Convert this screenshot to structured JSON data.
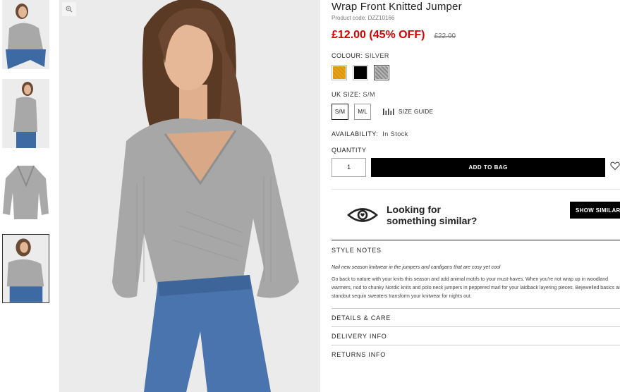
{
  "product": {
    "title": "Wrap Front Knitted Jumper",
    "code": "Product code: DZZ10166",
    "price": "£12.00 (45% OFF)",
    "old_price": "£22.00"
  },
  "colour": {
    "label": "COLOUR:",
    "value": "SILVER",
    "swatches": [
      {
        "name": "mustard",
        "color": "#e8a317"
      },
      {
        "name": "black",
        "color": "#000000"
      },
      {
        "name": "silver",
        "color": "#9a9a9a"
      }
    ]
  },
  "size": {
    "label": "UK SIZE:",
    "value": "S/M",
    "options": [
      "S/M",
      "M/L"
    ],
    "guide": "SIZE GUIDE"
  },
  "availability": {
    "label": "AVAILABILITY:",
    "value": "In Stock"
  },
  "quantity": {
    "label": "QUANTITY",
    "value": "1"
  },
  "actions": {
    "add_to_bag": "ADD TO BAG",
    "show_similar": "SHOW SIMILAR",
    "similar_line1": "Looking for",
    "similar_line2": "something similar?"
  },
  "style_notes": {
    "heading": "STYLE NOTES",
    "intro": "Nail new season knitwear in the jumpers and cardigans that are cosy yet cool",
    "body": "Go back to nature with your knits this season and add animal motifs to your must-haves. When you're not wrap up in woodland warmers, nod to chunky Nordic knits and polo neck jumpers in peppered marl for your laidback layering pieces. Bejewelled basics and standout sequin sweaters transform your knitwear for nights out."
  },
  "sections": [
    "DETAILS & CARE",
    "DELIVERY INFO",
    "RETURNS INFO"
  ],
  "icons": {
    "zoom": "zoom-icon",
    "size_guide": "ruler-icon",
    "wishlist": "heart-icon",
    "similar": "eye-icon"
  },
  "colors": {
    "price_red": "#d60000",
    "button_black": "#000000"
  }
}
